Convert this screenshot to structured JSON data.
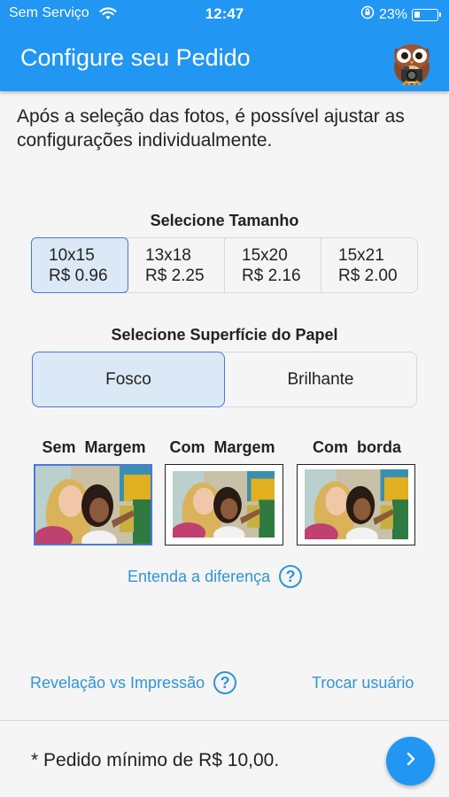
{
  "status": {
    "carrier": "Sem Serviço",
    "time": "12:47",
    "battery": "23%",
    "battery_level": 0.23
  },
  "header": {
    "title": "Configure seu Pedido"
  },
  "intro": "Após a seleção das fotos, é possível ajustar as configurações individualmente.",
  "size_section": {
    "label": "Selecione Tamanho",
    "options": [
      {
        "size": "10x15",
        "price": "R$ 0.96",
        "selected": true
      },
      {
        "size": "13x18",
        "price": "R$ 2.25",
        "selected": false
      },
      {
        "size": "15x20",
        "price": "R$ 2.16",
        "selected": false
      },
      {
        "size": "15x21",
        "price": "R$ 2.00",
        "selected": false
      }
    ]
  },
  "surface_section": {
    "label": "Selecione Superfície do Papel",
    "options": [
      {
        "label": "Fosco",
        "selected": true
      },
      {
        "label": "Brilhante",
        "selected": false
      }
    ]
  },
  "margin_section": {
    "options": [
      {
        "label": "Sem  Margem",
        "selected": true
      },
      {
        "label": "Com  Margem",
        "selected": false
      },
      {
        "label": "Com   borda",
        "selected": false
      }
    ]
  },
  "links": {
    "difference": "Entenda a diferença",
    "revelacao": "Revelação vs Impressão",
    "trocar": "Trocar usuário",
    "help_glyph": "?"
  },
  "footer": {
    "min_order": "* Pedido mínimo de R$ 10,00."
  },
  "colors": {
    "accent": "#2196f3",
    "selected_bg": "#dbe8f5",
    "selected_border": "#4a78d8",
    "link": "#2f95d8"
  },
  "icons": {
    "wifi": "wifi-icon",
    "next": "chevron-right-icon",
    "help": "question-circle-icon",
    "mascot": "owl-camera-logo"
  }
}
